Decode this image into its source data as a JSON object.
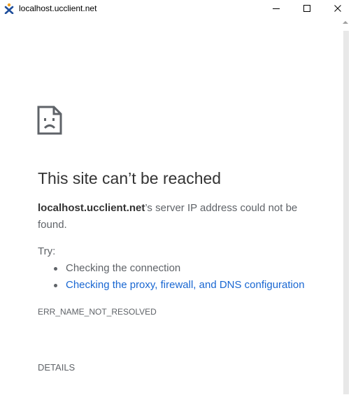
{
  "window": {
    "title": "localhost.ucclient.net",
    "app_icon": "x-logo-icon",
    "controls": {
      "minimize": "minimize-icon",
      "maximize": "maximize-icon",
      "close": "close-icon"
    }
  },
  "error_page": {
    "icon": "sad-page-icon",
    "headline": "This site can’t be reached",
    "host": "localhost.ucclient.net",
    "message_suffix": "’s server IP address could not be found.",
    "try_label": "Try:",
    "suggestions": [
      {
        "label": "Checking the connection",
        "is_link": false
      },
      {
        "label": "Checking the proxy, firewall, and DNS configuration",
        "is_link": true
      }
    ],
    "error_code": "ERR_NAME_NOT_RESOLVED",
    "details_label": "DETAILS"
  },
  "colors": {
    "headline": "#333333",
    "text": "#5f6368",
    "link": "#1967d2",
    "app_icon_blue": "#1f4e9b",
    "app_icon_orange": "#f0a020"
  }
}
